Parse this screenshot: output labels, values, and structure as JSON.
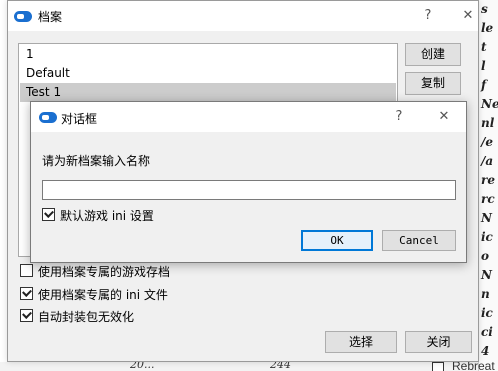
{
  "background": {
    "right_glyphs": [
      "s",
      "le",
      "t",
      "l",
      "f",
      "Ne",
      "nl",
      "/e",
      "/a",
      "re",
      "rc",
      "N",
      "ic",
      "o",
      "N",
      "n",
      "ic",
      "ci",
      "4"
    ],
    "bottom_texts": [
      "20...",
      "244"
    ],
    "bottom_right_label": "Rebreat"
  },
  "window": {
    "title": "档案",
    "help_glyph": "?",
    "close_glyph": "✕",
    "profiles": [
      "1",
      "Default",
      "Test 1"
    ],
    "selected_index": 2,
    "buttons": {
      "create": "创建",
      "copy": "复制",
      "select": "选择",
      "close": "关闭"
    },
    "options": [
      {
        "label": "使用档案专属的游戏存档",
        "checked": false
      },
      {
        "label": "使用档案专属的 ini 文件",
        "checked": true
      },
      {
        "label": "自动封装包无效化",
        "checked": true
      }
    ]
  },
  "dialog": {
    "title": "对话框",
    "help_glyph": "?",
    "close_glyph": "✕",
    "prompt": "请为新档案输入名称",
    "name_value": "",
    "default_ini_label": "默认游戏 ini 设置",
    "default_ini_checked": true,
    "ok_label": "OK",
    "cancel_label": "Cancel"
  },
  "colors": {
    "accent": "#0078d7",
    "selection": "#cccccc",
    "window_bg": "#f0f0f0"
  },
  "icons": {
    "app": "app-logo-icon",
    "help": "help-icon",
    "close": "close-icon",
    "check": "checkmark-icon"
  }
}
